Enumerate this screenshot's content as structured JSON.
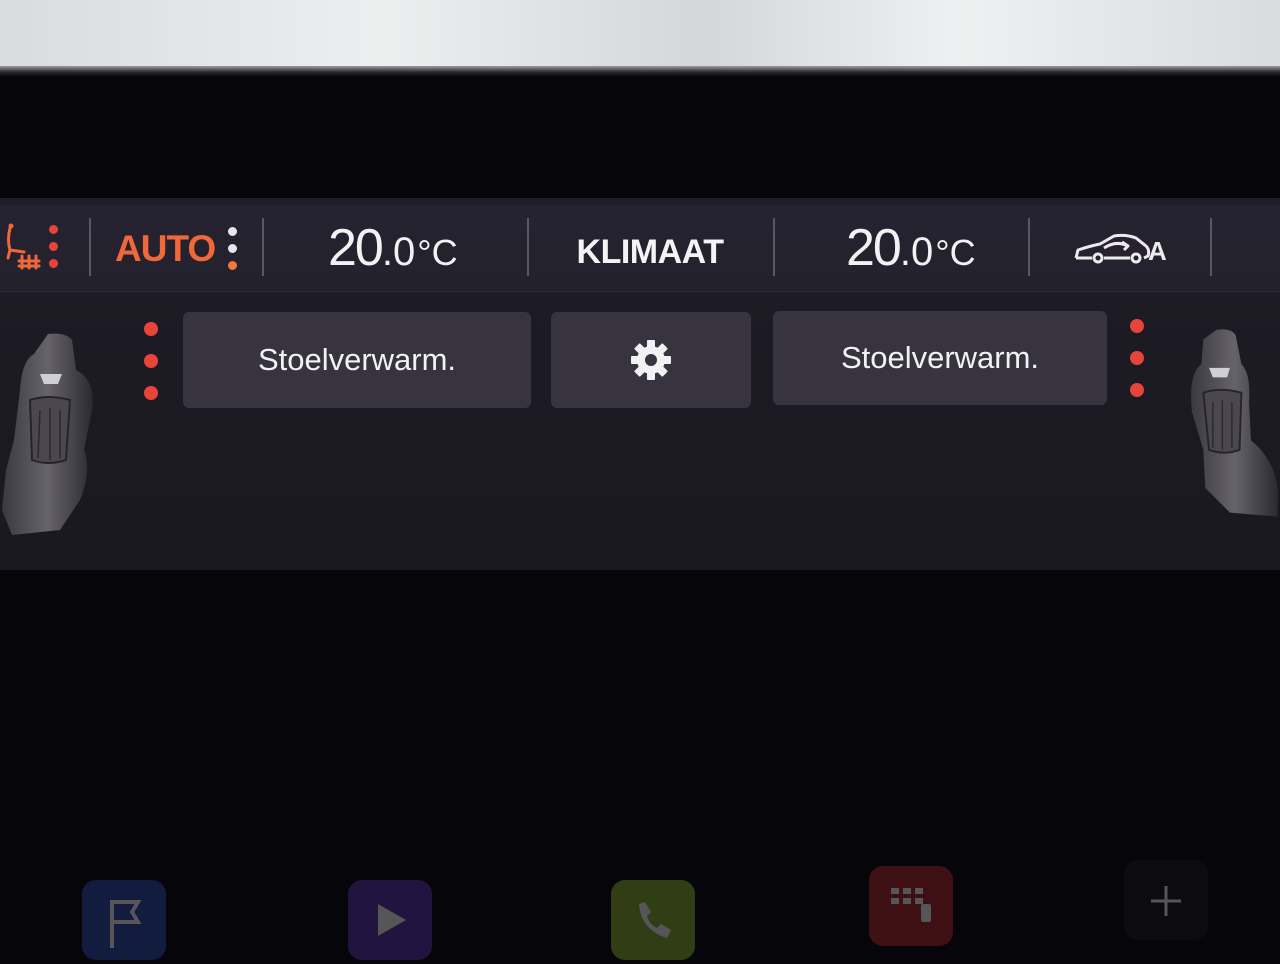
{
  "climate": {
    "mode_label": "AUTO",
    "title": "KLIMAAT",
    "left_temp": {
      "whole": "20",
      "decimal": ".0",
      "unit": "°C"
    },
    "right_temp": {
      "whole": "20",
      "decimal": ".0",
      "unit": "°C"
    },
    "air_mode_letter": "A"
  },
  "buttons": {
    "left_seat_heating": "Stoelverwarm.",
    "right_seat_heating": "Stoelverwarm."
  },
  "icons": {
    "seat_heat": "seat-heat-icon",
    "settings": "gear-icon",
    "recirculation": "car-air-recirculation-icon",
    "dock": [
      "flag-icon",
      "play-icon",
      "phone-icon",
      "apps-icon",
      "plus-icon"
    ]
  },
  "colors": {
    "accent_red": "#e8443a",
    "accent_orange": "#f0683a",
    "button_bg": "#37343f",
    "panel_bg": "#211e29"
  }
}
